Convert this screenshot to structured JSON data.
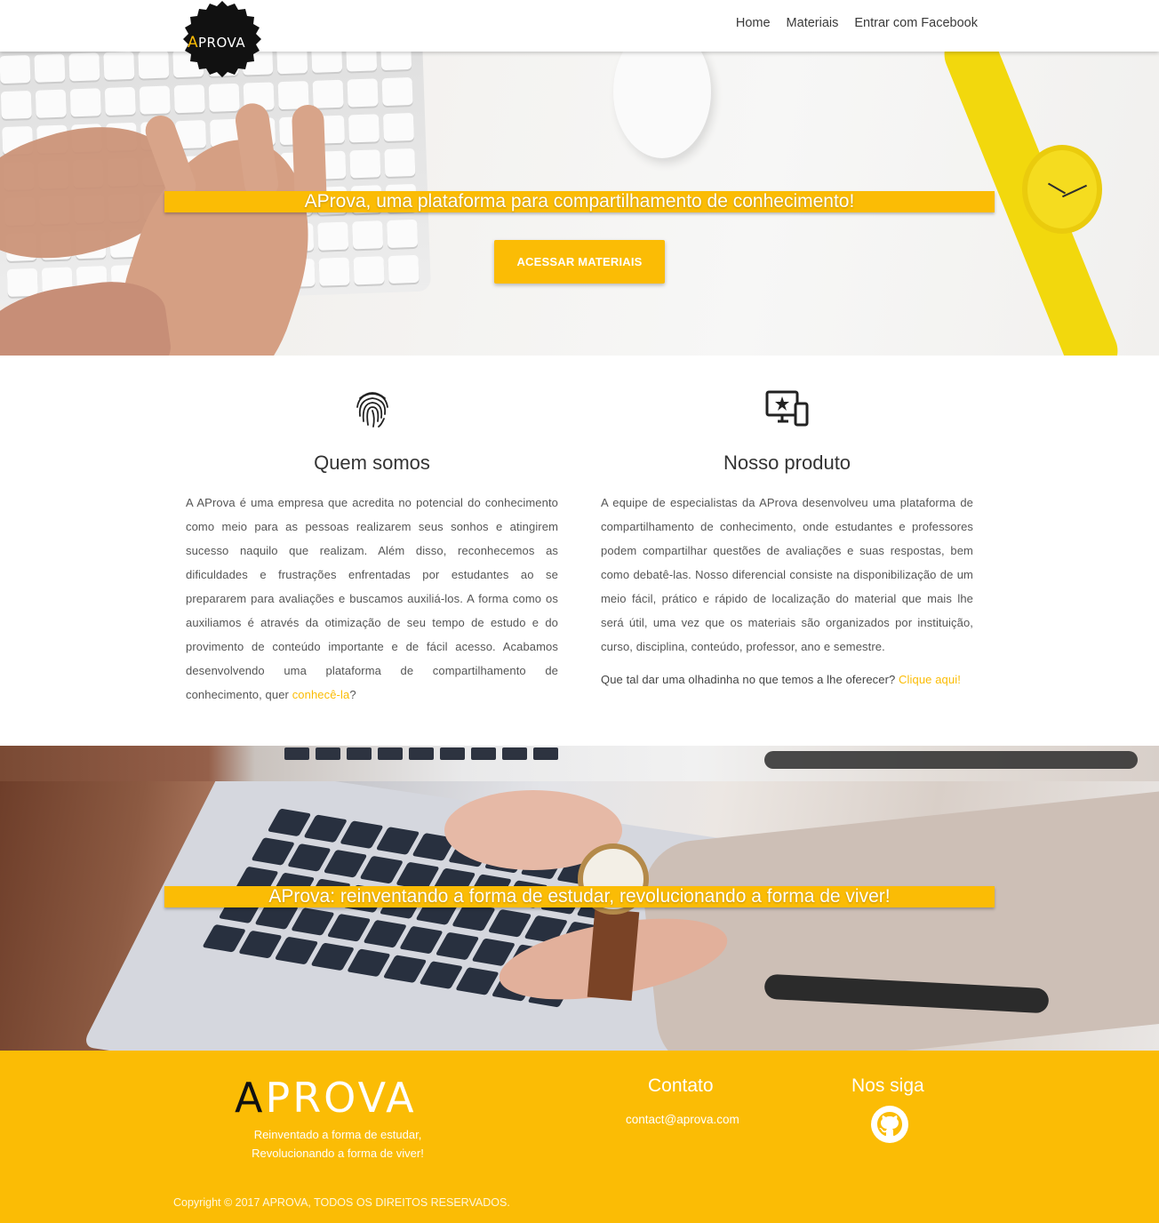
{
  "nav": {
    "logo_text": "APROVA",
    "links": [
      "Home",
      "Materiais",
      "Entrar com Facebook"
    ]
  },
  "hero": {
    "banner": "AProva, uma plataforma para compartilhamento de conhecimento!",
    "cta": "ACESSAR MATERIAIS"
  },
  "features": {
    "left": {
      "icon": "fingerprint-icon",
      "title": "Quem somos",
      "text": "A AProva é uma empresa que acredita no potencial do conhecimento como meio para as pessoas realizarem seus sonhos e atingirem sucesso naquilo que realizam. Além disso, reconhecemos as dificuldades e frustrações enfrentadas por estudantes ao se prepararem para avaliações e buscamos auxiliá-los. A forma como os auxiliamos é através da otimização de seu tempo de estudo e do provimento de conteúdo importante e de fácil acesso. Acabamos desenvolvendo uma plataforma de compartilhamento de conhecimento, quer ",
      "link": "conhecê-la",
      "suffix": "?"
    },
    "right": {
      "icon": "devices-icon",
      "title": "Nosso produto",
      "text": "A equipe de especialistas da AProva desenvolveu uma plataforma de compartilhamento de conhecimento, onde estudantes e professores podem compartilhar questões de avaliações e suas respostas, bem como debatê-las. Nosso diferencial consiste na disponibilização de um meio fácil, prático e rápido de localização do material que mais lhe será útil, uma vez que os materiais são organizados por instituição, curso, disciplina, conteúdo, professor, ano e semestre.",
      "cta_text": "Que tal dar uma olhadinha no que temos a lhe oferecer? ",
      "cta_link": "Clique aqui!"
    }
  },
  "second_banner": "AProva: reinventando a forma de estudar, revolucionando a forma de viver!",
  "footer": {
    "logo_a": "A",
    "logo_rest": "PROVA",
    "tagline_1": "Reinventado a forma de estudar,",
    "tagline_2": "Revolucionando a forma de viver!",
    "contact_title": "Contato",
    "contact_email": "contact@aprova.com",
    "follow_title": "Nos siga",
    "follow_icon": "github-icon",
    "copyright": "Copyright © 2017 APROVA, TODOS OS DIREITOS RESERVADOS."
  },
  "colors": {
    "accent": "#fbbc05",
    "logo_badge": "#111111"
  }
}
